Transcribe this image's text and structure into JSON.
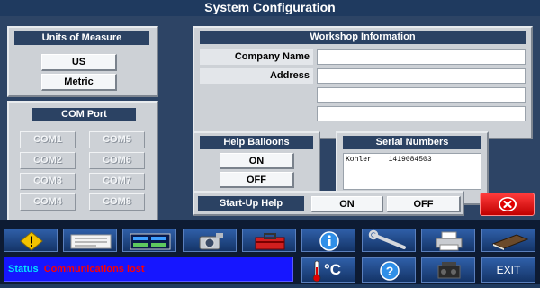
{
  "title": "System Configuration",
  "units": {
    "heading": "Units of Measure",
    "options": [
      "US",
      "Metric"
    ]
  },
  "com_port": {
    "heading": "COM Port",
    "ports": [
      "COM1",
      "COM2",
      "COM3",
      "COM4",
      "COM5",
      "COM6",
      "COM7",
      "COM8"
    ]
  },
  "workshop": {
    "heading": "Workshop Information",
    "company_label": "Company Name",
    "address_label": "Address",
    "company_value": "",
    "address_values": [
      "",
      "",
      ""
    ]
  },
  "help_balloons": {
    "heading": "Help Balloons",
    "on": "ON",
    "off": "OFF"
  },
  "serial_numbers": {
    "heading": "Serial Numbers",
    "entries": [
      {
        "name": "Kohler",
        "serial": "1419084503"
      }
    ]
  },
  "startup_help": {
    "label": "Start-Up Help",
    "on": "ON",
    "off": "OFF"
  },
  "toolbar": {
    "icons": [
      "warning-icon",
      "document-icon",
      "data-display-icon",
      "camera-icon",
      "toolbox-icon",
      "info-icon",
      "wrench-icon",
      "printer-icon",
      "book-icon",
      "thermometer-celsius-icon",
      "help-icon",
      "engine-icon"
    ],
    "temp_unit": "°C",
    "exit_label": "EXIT"
  },
  "status": {
    "label": "Status",
    "message": "Communications lost"
  },
  "colors": {
    "accent": "#1f3a5f",
    "status_bg": "#1616ff",
    "status_label": "#00e5ff",
    "status_text": "#ff0000",
    "close_button": "#e00000"
  }
}
